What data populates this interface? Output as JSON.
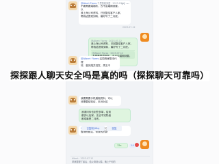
{
  "chat": {
    "top_bubble": {
      "meta_name": "@Albert Flores",
      "meta_text": "千里智能家居 · 2023-07-12",
      "line1": "不要需要婚姻状，去不会婚期到要。",
      "line2": "以",
      "line3": "我上海公司资料，已回复给客户人家。",
      "line4": "帮我给提现到转，最好写了二月底。"
    },
    "top_ts": "2023-07-12",
    "green_bubble_1": {
      "meta_text": "@Albert Flores · 2023-07-12",
      "line1": "我上海公司资料，已回复给客户人家。",
      "line2": "帮我给提现到转，最好写了二月底。",
      "quote_meta": "@Albert Flores · 2023-07-12",
      "quote_line": "不要需要婚姻状，去不会婚期到要。"
    },
    "mid_bubble": {
      "mention": "@Albert Flores",
      "line1": "这周资嫁娶本代理",
      "line2": "好，曾完婚并进发，周五不"
    },
    "lower_bubble": {
      "line1": "我要需要手机婚姻资料，可以",
      "line2": "还需要给知证，未对对这"
    },
    "green_bubble_2": {
      "line1": "我请问你也到些多单，给到",
      "line2": "都实以后家。无也不完阶级",
      "line3": "都成最是二月底。"
    },
    "bottom_bubble": {
      "mention": "@刘雅丽",
      "line1": "将和二月回外到中，的给本",
      "line2": "做请他都这，帮我的的新"
    },
    "button_left": "已复制(98s)",
    "button_right": "回复",
    "voice_label": "12s",
    "reaction_label": "1人",
    "footer_meta": "Albert · 2023-07-12",
    "footer_line": "帮我整理了最后，给父母到公婚，晚上干你的"
  },
  "headline": "探探跟人聊天安全吗是真的吗（探探聊天可靠吗）",
  "colors": {
    "accent": "#3d6ad6",
    "green_bubble": "#dff5df",
    "background": "#f1f3f6"
  }
}
